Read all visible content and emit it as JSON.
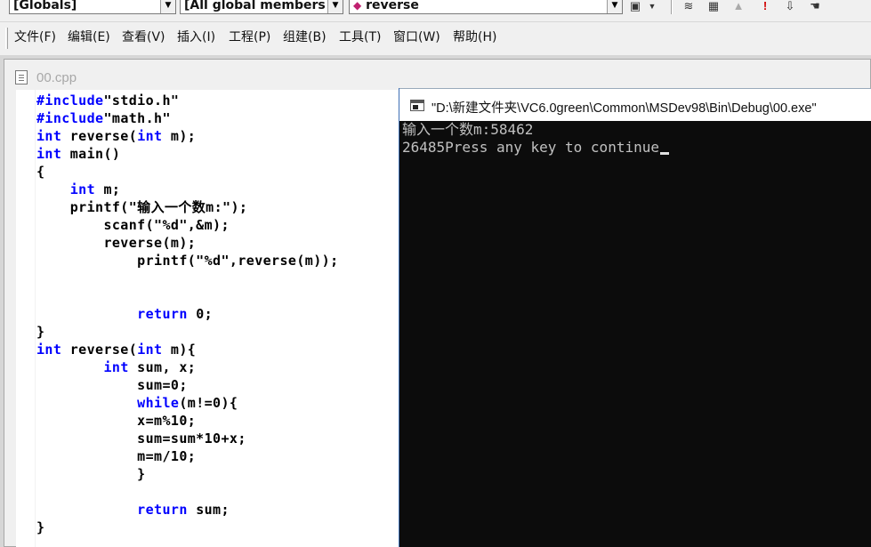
{
  "wizardbar": {
    "class_combo": "[Globals]",
    "filter_combo": "[All global members",
    "member_combo": "reverse",
    "colors": {
      "member_icon": "#c02070"
    }
  },
  "menubar": {
    "items": [
      "文件(F)",
      "编辑(E)",
      "查看(V)",
      "插入(I)",
      "工程(P)",
      "组建(B)",
      "工具(T)",
      "窗口(W)",
      "帮助(H)"
    ]
  },
  "document": {
    "title": "00.cpp",
    "code_lines": [
      {
        "parts": [
          {
            "t": "#include",
            "c": "kw"
          },
          {
            "t": "\"stdio.h\"",
            "c": "tx"
          }
        ]
      },
      {
        "parts": [
          {
            "t": "#include",
            "c": "kw"
          },
          {
            "t": "\"math.h\"",
            "c": "tx"
          }
        ]
      },
      {
        "parts": [
          {
            "t": "int",
            "c": "kw"
          },
          {
            "t": " reverse(",
            "c": "tx"
          },
          {
            "t": "int",
            "c": "kw"
          },
          {
            "t": " m);",
            "c": "tx"
          }
        ]
      },
      {
        "parts": [
          {
            "t": "int",
            "c": "kw"
          },
          {
            "t": " main()",
            "c": "tx"
          }
        ]
      },
      {
        "parts": [
          {
            "t": "{",
            "c": "tx"
          }
        ]
      },
      {
        "parts": [
          {
            "t": "    ",
            "c": "tx"
          },
          {
            "t": "int",
            "c": "kw"
          },
          {
            "t": " m;",
            "c": "tx"
          }
        ]
      },
      {
        "parts": [
          {
            "t": "    printf(\"输入一个数m:\");",
            "c": "tx"
          }
        ]
      },
      {
        "parts": [
          {
            "t": "        scanf(\"%d\",&m);",
            "c": "tx"
          }
        ]
      },
      {
        "parts": [
          {
            "t": "        reverse(m);",
            "c": "tx"
          }
        ]
      },
      {
        "parts": [
          {
            "t": "            printf(\"%d\",reverse(m));",
            "c": "tx"
          }
        ]
      },
      {
        "parts": [
          {
            "t": "",
            "c": "tx"
          }
        ]
      },
      {
        "parts": [
          {
            "t": "",
            "c": "tx"
          }
        ]
      },
      {
        "parts": [
          {
            "t": "            ",
            "c": "tx"
          },
          {
            "t": "return",
            "c": "kw"
          },
          {
            "t": " 0;",
            "c": "tx"
          }
        ]
      },
      {
        "parts": [
          {
            "t": "}",
            "c": "tx"
          }
        ]
      },
      {
        "parts": [
          {
            "t": "int",
            "c": "kw"
          },
          {
            "t": " reverse(",
            "c": "tx"
          },
          {
            "t": "int",
            "c": "kw"
          },
          {
            "t": " m){",
            "c": "tx"
          }
        ]
      },
      {
        "parts": [
          {
            "t": "        ",
            "c": "tx"
          },
          {
            "t": "int",
            "c": "kw"
          },
          {
            "t": " sum, x;",
            "c": "tx"
          }
        ]
      },
      {
        "parts": [
          {
            "t": "            sum=0;",
            "c": "tx"
          }
        ]
      },
      {
        "parts": [
          {
            "t": "            ",
            "c": "tx"
          },
          {
            "t": "while",
            "c": "kw"
          },
          {
            "t": "(m!=0){",
            "c": "tx"
          }
        ]
      },
      {
        "parts": [
          {
            "t": "            x=m%10;",
            "c": "tx"
          }
        ]
      },
      {
        "parts": [
          {
            "t": "            sum=sum*10+x;",
            "c": "tx"
          }
        ]
      },
      {
        "parts": [
          {
            "t": "            m=m/10;",
            "c": "tx"
          }
        ]
      },
      {
        "parts": [
          {
            "t": "            }",
            "c": "tx"
          }
        ]
      },
      {
        "parts": [
          {
            "t": "",
            "c": "tx"
          }
        ]
      },
      {
        "parts": [
          {
            "t": "            ",
            "c": "tx"
          },
          {
            "t": "return",
            "c": "kw"
          },
          {
            "t": " sum;",
            "c": "tx"
          }
        ]
      },
      {
        "parts": [
          {
            "t": "}",
            "c": "tx"
          }
        ]
      }
    ],
    "colors": {
      "keyword": "#0000ff",
      "text": "#000000"
    }
  },
  "console": {
    "title": "\"D:\\新建文件夹\\VC6.0green\\Common\\MSDev98\\Bin\\Debug\\00.exe\"",
    "lines": [
      "输入一个数m:58462",
      "26485Press any key to continue"
    ]
  }
}
